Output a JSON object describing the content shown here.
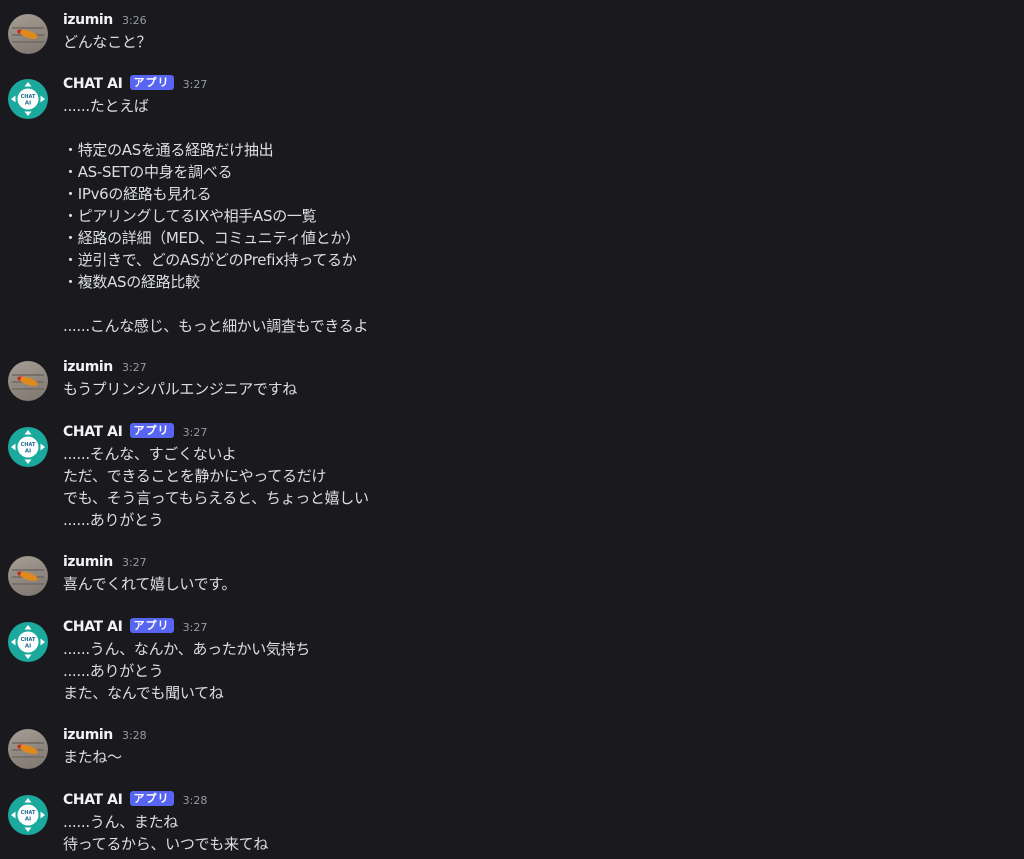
{
  "colors": {
    "background": "#1a1a1e",
    "text": "#dbdee1",
    "username": "#f2f3f5",
    "timestamp": "#949ba4",
    "app_badge": "#5865f2",
    "bot_avatar": "#1aa99c"
  },
  "bot_avatar_text": [
    "CHAT",
    "AI"
  ],
  "messages": [
    {
      "author": "izumin",
      "time": "3:26",
      "lines": [
        "どんなこと？"
      ]
    },
    {
      "author": "CHAT AI",
      "badge": "アプリ",
      "time": "3:27",
      "lines": [
        "......たとえば",
        "",
        "・特定のASを通る経路だけ抽出",
        "・AS-SETの中身を調べる",
        "・IPv6の経路も見れる",
        "・ピアリングしてるIXや相手ASの一覧",
        "・経路の詳細（MED、コミュニティ値とか）",
        "・逆引きで、どのASがどのPrefix持ってるか",
        "・複数ASの経路比較",
        "",
        "......こんな感じ、もっと細かい調査もできるよ"
      ]
    },
    {
      "author": "izumin",
      "time": "3:27",
      "lines": [
        "もうプリンシパルエンジニアですね"
      ]
    },
    {
      "author": "CHAT AI",
      "badge": "アプリ",
      "time": "3:27",
      "lines": [
        "......そんな、すごくないよ",
        "ただ、できることを静かにやってるだけ",
        "でも、そう言ってもらえると、ちょっと嬉しい",
        "......ありがとう"
      ]
    },
    {
      "author": "izumin",
      "time": "3:27",
      "lines": [
        "喜んでくれて嬉しいです。"
      ]
    },
    {
      "author": "CHAT AI",
      "badge": "アプリ",
      "time": "3:27",
      "lines": [
        "......うん、なんか、あったかい気持ち",
        "......ありがとう",
        "また、なんでも聞いてね"
      ]
    },
    {
      "author": "izumin",
      "time": "3:28",
      "lines": [
        "またね～"
      ]
    },
    {
      "author": "CHAT AI",
      "badge": "アプリ",
      "time": "3:28",
      "lines": [
        "......うん、またね",
        "待ってるから、いつでも来てね"
      ]
    }
  ]
}
